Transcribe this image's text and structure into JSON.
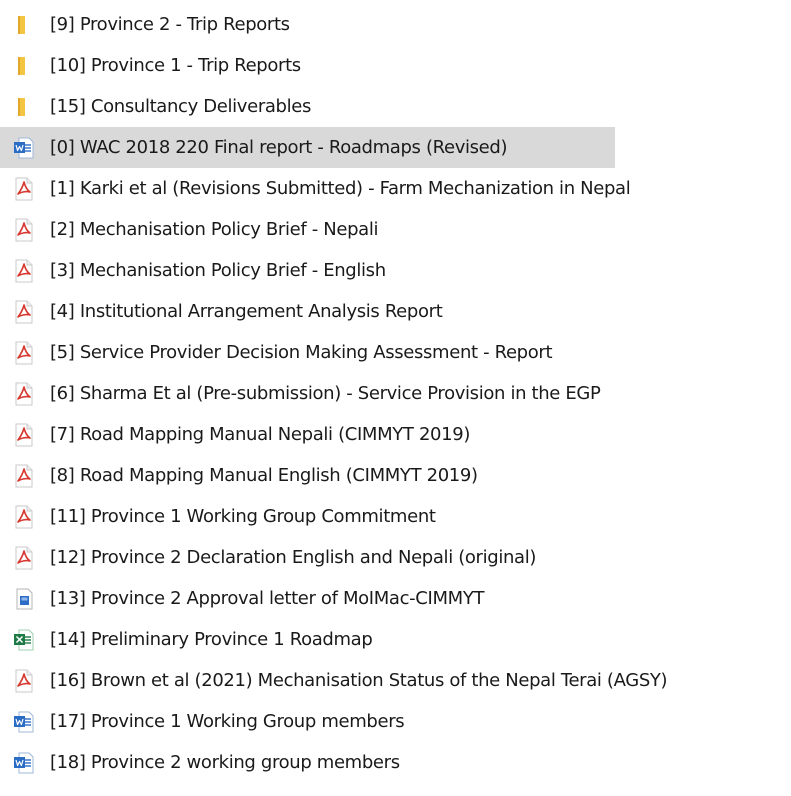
{
  "items": [
    {
      "name": "[9] Province 2 - Trip Reports",
      "type": "folder"
    },
    {
      "name": "[10] Province 1 - Trip Reports",
      "type": "folder"
    },
    {
      "name": "[15] Consultancy Deliverables",
      "type": "folder"
    },
    {
      "name": "[0] WAC  2018  220 Final report - Roadmaps (Revised)",
      "type": "word",
      "selected": true
    },
    {
      "name": "[1] Karki et al (Revisions Submitted) - Farm Mechanization in Nepal",
      "type": "pdf"
    },
    {
      "name": "[2] Mechanisation Policy Brief - Nepali",
      "type": "pdf"
    },
    {
      "name": "[3] Mechanisation Policy Brief   - English",
      "type": "pdf"
    },
    {
      "name": "[4] Institutional Arrangement Analysis Report",
      "type": "pdf"
    },
    {
      "name": "[5] Service Provider Decision Making Assessment - Report",
      "type": "pdf"
    },
    {
      "name": "[6] Sharma Et al (Pre-submission) - Service Provision in the EGP",
      "type": "pdf"
    },
    {
      "name": "[7] Road Mapping Manual Nepali (CIMMYT 2019)",
      "type": "pdf"
    },
    {
      "name": "[8] Road Mapping Manual English (CIMMYT 2019)",
      "type": "pdf"
    },
    {
      "name": "[11] Province 1 Working Group Commitment",
      "type": "pdf"
    },
    {
      "name": "[12] Province 2 Declaration English and Nepali (original)",
      "type": "pdf"
    },
    {
      "name": "[13] Province 2 Approval letter of MoIMac-CIMMYT",
      "type": "image"
    },
    {
      "name": "[14] Preliminary Province 1 Roadmap",
      "type": "excel"
    },
    {
      "name": "[16] Brown et al (2021) Mechanisation Status of the Nepal Terai (AGSY)",
      "type": "pdf"
    },
    {
      "name": "[17] Province 1 Working Group members",
      "type": "word"
    },
    {
      "name": "[18] Province 2 working group members",
      "type": "word"
    }
  ],
  "colors": {
    "selection": "#d9d9d9",
    "folder": "#f4c542",
    "pdf": "#d7372f",
    "word": "#2b6cc4",
    "excel": "#1e7a44"
  }
}
